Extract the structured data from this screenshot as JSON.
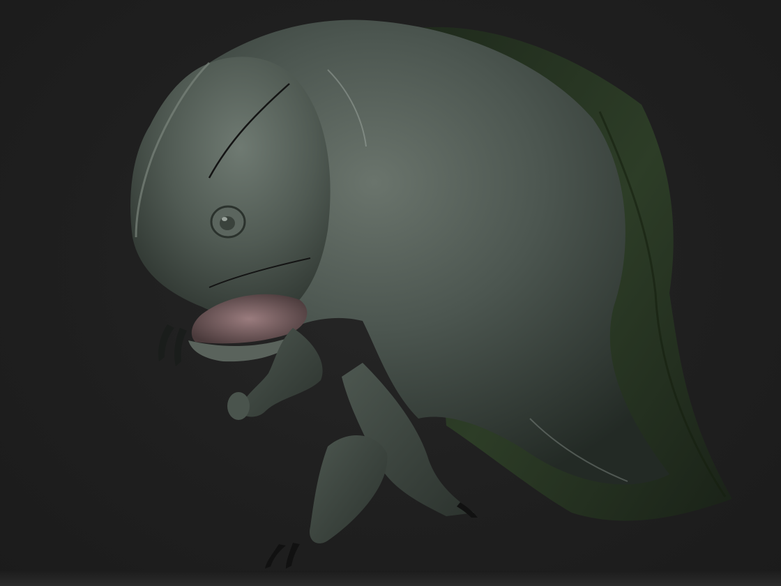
{
  "scene": {
    "subject": "creature-sculpt",
    "background_color": "#1e1e1e",
    "skin_color": "#4a544d",
    "fin_color": "#2a3a26",
    "mouth_color": "#8a6e70"
  }
}
